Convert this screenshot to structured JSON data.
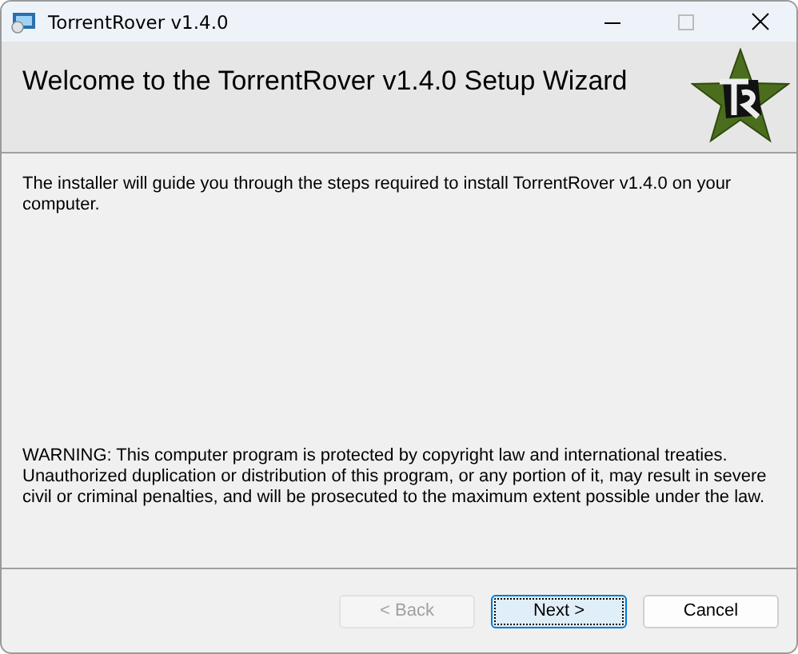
{
  "window": {
    "title": "TorrentRover v1.4.0"
  },
  "header": {
    "title": "Welcome to the TorrentRover v1.4.0 Setup Wizard"
  },
  "intro": "The installer will guide you through the steps required to install TorrentRover v1.4.0 on your computer.",
  "warning": "WARNING: This computer program is protected by copyright law and international treaties. Unauthorized duplication or distribution of this program, or any portion of it, may result in severe civil or criminal penalties, and will be prosecuted to the maximum extent possible under the law.",
  "buttons": [
    {
      "label": "< Back",
      "disabled": true,
      "default": false
    },
    {
      "label": "Next >",
      "disabled": false,
      "default": true
    },
    {
      "label": "Cancel",
      "disabled": false,
      "default": false
    }
  ]
}
